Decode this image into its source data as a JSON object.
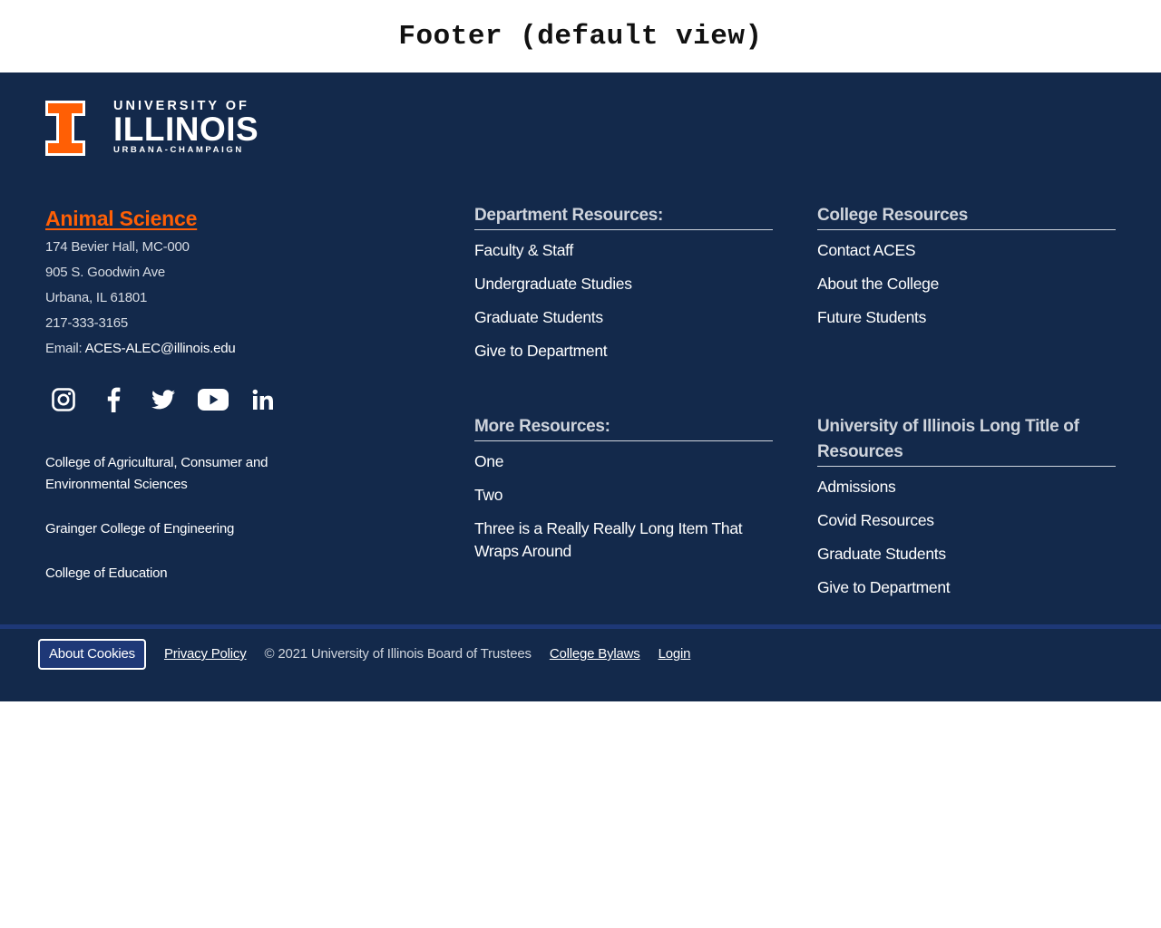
{
  "page": {
    "heading": "Footer (default view)"
  },
  "logo": {
    "line1": "UNIVERSITY OF",
    "line2": "ILLINOIS",
    "line3": "URBANA-CHAMPAIGN",
    "accent_color": "#ff5f05"
  },
  "contact": {
    "unit_name": "Animal Science",
    "address_lines": [
      "174 Bevier Hall, MC-000",
      "905 S. Goodwin Ave",
      "Urbana, IL 61801"
    ],
    "phone": "217-333-3165",
    "email_label": "Email:",
    "email": "ACES-ALEC@illinois.edu"
  },
  "social": [
    {
      "name": "Instagram",
      "icon": "instagram-icon"
    },
    {
      "name": "Facebook",
      "icon": "facebook-icon"
    },
    {
      "name": "Twitter",
      "icon": "twitter-icon"
    },
    {
      "name": "YouTube",
      "icon": "youtube-icon"
    },
    {
      "name": "LinkedIn",
      "icon": "linkedin-icon"
    }
  ],
  "colleges": [
    "College of Agricultural, Consumer and Environmental Sciences",
    "Grainger College of Engineering",
    "College of Education"
  ],
  "columns": {
    "department": {
      "title": "Department Resources:",
      "items": [
        "Faculty & Staff",
        "Undergraduate Studies",
        "Graduate Students",
        "Give to Department"
      ]
    },
    "college": {
      "title": "College Resources",
      "items": [
        "Contact ACES",
        "About the College",
        "Future Students"
      ]
    },
    "more": {
      "title": "More Resources:",
      "items": [
        "One",
        "Two",
        "Three is a Really Really Long Item That Wraps Around"
      ]
    },
    "university": {
      "title": "University of Illinois Long Title of Resources",
      "items": [
        "Admissions",
        "Covid Resources",
        "Graduate Students",
        "Give to Department"
      ]
    }
  },
  "bottom_bar": {
    "cookies_label": "About Cookies",
    "privacy_label": "Privacy Policy",
    "copyright": "© 2021 University of Illinois Board of Trustees",
    "bylaws_label": "College Bylaws",
    "login_label": "Login"
  },
  "colors": {
    "footer_background": "#13294b",
    "accent_orange": "#ff5f05",
    "bottom_border": "#1e3877"
  }
}
